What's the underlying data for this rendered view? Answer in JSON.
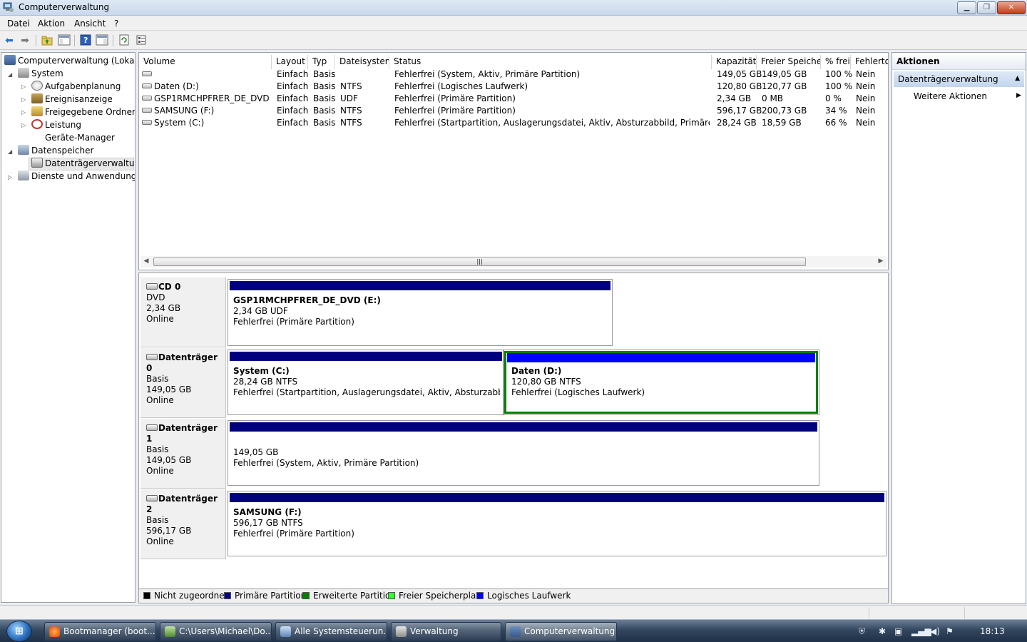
{
  "window": {
    "title": "Computerverwaltung"
  },
  "menu": [
    "Datei",
    "Aktion",
    "Ansicht",
    "?"
  ],
  "tree": {
    "root": "Computerverwaltung (Lokal)",
    "system": "System",
    "aufgabenplanung": "Aufgabenplanung",
    "ereignisanzeige": "Ereignisanzeige",
    "freigegebene_ordner": "Freigegebene Ordner",
    "leistung": "Leistung",
    "geraete_manager": "Geräte-Manager",
    "datenspeicher": "Datenspeicher",
    "datentraegerverwaltung": "Datenträgerverwaltung",
    "dienste": "Dienste und Anwendungen"
  },
  "list": {
    "columns": [
      "Volume",
      "Layout",
      "Typ",
      "Dateisystem",
      "Status",
      "Kapazität",
      "Freier Speicher",
      "% frei",
      "Fehlertol"
    ],
    "rows": [
      [
        "",
        "Einfach",
        "Basis",
        "",
        "Fehlerfrei (System, Aktiv, Primäre Partition)",
        "149,05 GB",
        "149,05 GB",
        "100 %",
        "Nein"
      ],
      [
        "Daten (D:)",
        "Einfach",
        "Basis",
        "NTFS",
        "Fehlerfrei (Logisches Laufwerk)",
        "120,80 GB",
        "120,77 GB",
        "100 %",
        "Nein"
      ],
      [
        "GSP1RMCHPFRER_DE_DVD (E:)",
        "Einfach",
        "Basis",
        "UDF",
        "Fehlerfrei (Primäre Partition)",
        "2,34 GB",
        "0 MB",
        "0 %",
        "Nein"
      ],
      [
        "SAMSUNG (F:)",
        "Einfach",
        "Basis",
        "NTFS",
        "Fehlerfrei (Primäre Partition)",
        "596,17 GB",
        "200,73 GB",
        "34 %",
        "Nein"
      ],
      [
        "System (C:)",
        "Einfach",
        "Basis",
        "NTFS",
        "Fehlerfrei (Startpartition, Auslagerungsdatei, Aktiv, Absturzabbild, Primäre Partition)",
        "28,24 GB",
        "18,59 GB",
        "66 %",
        "Nein"
      ]
    ]
  },
  "disks": {
    "cd0": {
      "name": "CD 0",
      "type": "DVD",
      "size": "2,34 GB",
      "state": "Online",
      "part": {
        "name": "GSP1RMCHPFRER_DE_DVD  (E:)",
        "size": "2,34 GB UDF",
        "status": "Fehlerfrei (Primäre Partition)"
      }
    },
    "disk0": {
      "name": "Datenträger 0",
      "type": "Basis",
      "size": "149,05 GB",
      "state": "Online",
      "part_c": {
        "name": "System  (C:)",
        "size": "28,24 GB NTFS",
        "status": "Fehlerfrei (Startpartition, Auslagerungsdatei, Aktiv, Absturzabbild, Prim"
      },
      "part_d": {
        "name": "Daten  (D:)",
        "size": "120,80 GB NTFS",
        "status": "Fehlerfrei (Logisches Laufwerk)"
      }
    },
    "disk1": {
      "name": "Datenträger 1",
      "type": "Basis",
      "size": "149,05 GB",
      "state": "Online",
      "part": {
        "size": "149,05 GB",
        "status": "Fehlerfrei (System, Aktiv, Primäre Partition)"
      }
    },
    "disk2": {
      "name": "Datenträger 2",
      "type": "Basis",
      "size": "596,17 GB",
      "state": "Online",
      "part": {
        "name": "SAMSUNG  (F:)",
        "size": "596,17 GB NTFS",
        "status": "Fehlerfrei (Primäre Partition)"
      }
    }
  },
  "legend": {
    "unallocated": "Nicht zugeordnet",
    "primary": "Primäre Partition",
    "extended": "Erweiterte Partition",
    "free": "Freier Speicherplatz",
    "logical": "Logisches Laufwerk"
  },
  "colors": {
    "unallocated": "#000000",
    "primary": "#00007f",
    "extended": "#008000",
    "free": "#33ff33",
    "logical": "#0000ff",
    "selection": "#008000"
  },
  "actions": {
    "title": "Aktionen",
    "section": "Datenträgerverwaltung",
    "more": "Weitere Aktionen"
  },
  "taskbar": {
    "start_label": "⊞",
    "tasks": [
      "Bootmanager (boot...",
      "C:\\Users\\Michael\\Do...",
      "Alle Systemsteuerun...",
      "Verwaltung",
      "Computerverwaltung"
    ],
    "clock": "18:13"
  }
}
